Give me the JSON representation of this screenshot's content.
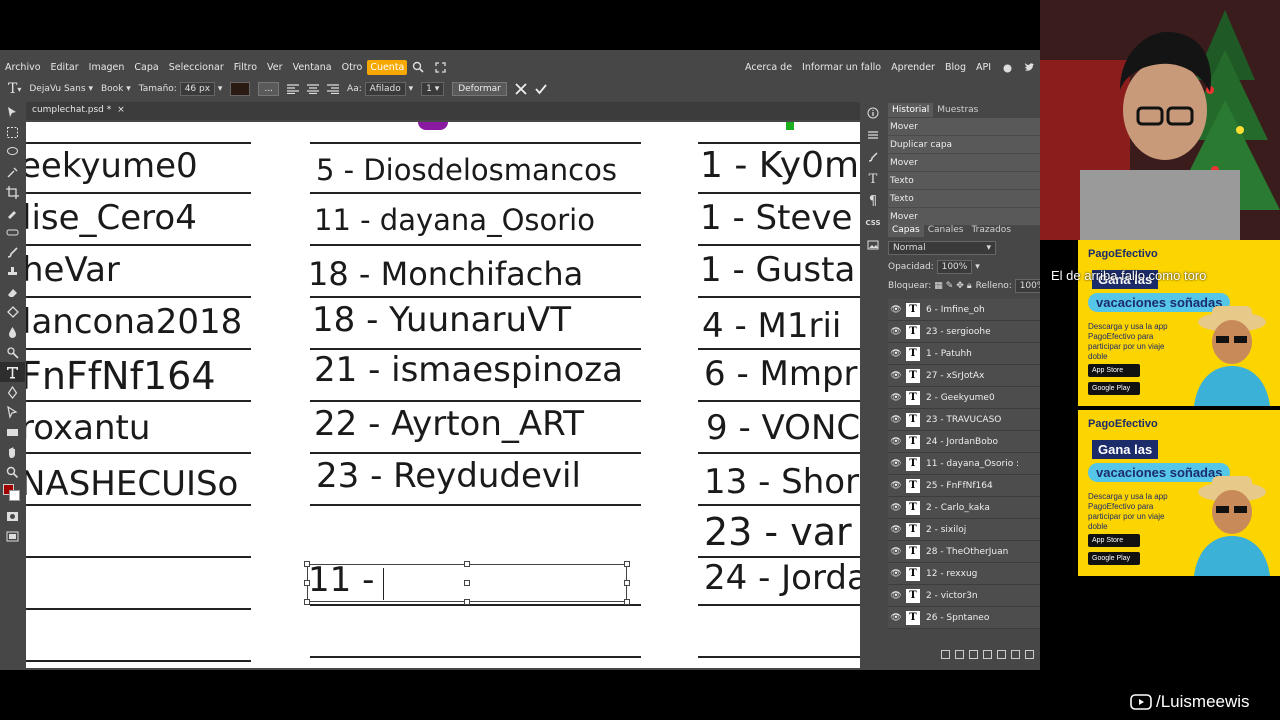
{
  "menu": {
    "items": [
      "Archivo",
      "Editar",
      "Imagen",
      "Capa",
      "Seleccionar",
      "Filtro",
      "Ver",
      "Ventana",
      "Otro"
    ],
    "account": "Cuenta",
    "right_items": [
      "Acerca de",
      "Informar un fallo",
      "Aprender",
      "Blog",
      "API"
    ]
  },
  "options": {
    "font": "DejaVu Sans",
    "style": "Book",
    "size_label": "Tamaño:",
    "size_value": "46 px",
    "aa_label": "Aa:",
    "aa_value": "Afilado",
    "spacing": "1",
    "deform": "Deformar",
    "dots": "..."
  },
  "document": {
    "tab_name": "cumplechat.psd *",
    "close": "×"
  },
  "canvas": {
    "col1": [
      "eekyume0",
      "lise_Cero4",
      "heVar",
      "lancona2018",
      "FnFfNf164",
      "roxantu",
      "NASHECUISo"
    ],
    "col2": [
      "5 - Diosdelosmancos",
      "11 - dayana_Osorio",
      "18 - Monchifacha",
      "18 - YuunaruVT",
      "21 - ismaespinoza",
      "22 - Ayrton_ART",
      "23 - Reydudevil"
    ],
    "col2_editing": "11 -",
    "col3": [
      "1 - Ky0m",
      "1 - Steve",
      "1 - Gusta",
      "4 - M1rii",
      "6 - Mmpr",
      "9 - VONC",
      "13 - Shor",
      "23 - var",
      "24 - Jorda"
    ]
  },
  "history": {
    "tabs": [
      "Historial",
      "Muestras"
    ],
    "entries": [
      "Mover",
      "Duplicar capa",
      "Mover",
      "Texto",
      "Texto",
      "Mover"
    ]
  },
  "layers": {
    "tabs": [
      "Capas",
      "Canales",
      "Trazados"
    ],
    "blend": "Normal",
    "opacity_label": "Opacidad:",
    "opacity_value": "100%",
    "lock_label": "Bloquear:",
    "fill_label": "Relleno:",
    "fill_value": "100%",
    "items": [
      "6 - Imfine_oh",
      "23 - sergioohe",
      "1 - Patuhh",
      "27 - xSrJotAx",
      "2 - Geekyume0",
      "23 - TRAVUCASO",
      "24 - JordanBobo",
      "11 - dayana_Osorio :",
      "25 - FnFfNf164",
      "2 - Carlo_kaka",
      "2 - sixiloj",
      "28 - TheOtherJuan",
      "12 - rexxug",
      "2 - victor3n",
      "26 - Spntaneo"
    ],
    "layer_glyph": "T"
  },
  "ads": [
    {
      "brand": "PagoEfectivo",
      "line1": "Gana las",
      "line2": "vacaciones soñadas",
      "desc": "Descarga y usa la app PagoEfectivo para participar por un viaje doble",
      "appstore": "App Store",
      "googleplay": "Google Play"
    },
    {
      "brand": "PagoEfectivo",
      "line1": "Gana las",
      "line2": "vacaciones soñadas",
      "desc": "Descarga y usa la app PagoEfectivo para participar por un viaje doble",
      "appstore": "App Store",
      "googleplay": "Google Play"
    }
  ],
  "stream": {
    "overlay": "El de arriba fallo como toro",
    "handle": "/Luismeewis"
  },
  "colors": {
    "accent": "#f6a800",
    "fg": "#a00000",
    "bg": "#ffffff",
    "panel": "#474747"
  }
}
